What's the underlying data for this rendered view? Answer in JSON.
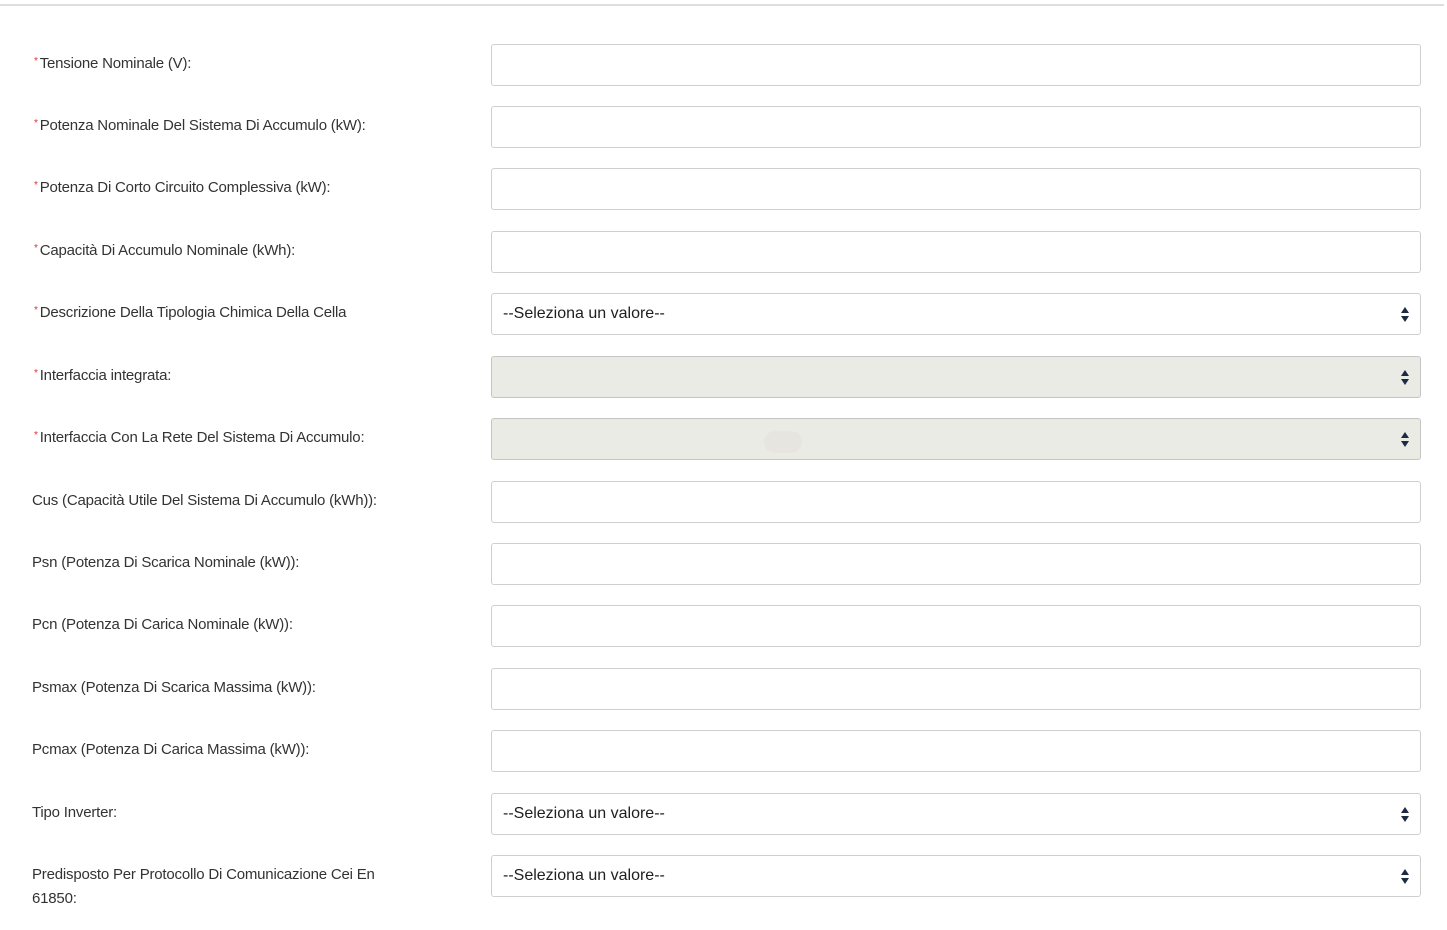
{
  "form": {
    "select_placeholder": "--Seleziona un valore--",
    "fields": [
      {
        "label": "Tensione Nominale (V):",
        "required": true,
        "type": "input",
        "value": ""
      },
      {
        "label": "Potenza Nominale Del Sistema Di Accumulo (kW):",
        "required": true,
        "type": "input",
        "value": ""
      },
      {
        "label": "Potenza Di Corto Circuito Complessiva (kW):",
        "required": true,
        "type": "input",
        "value": ""
      },
      {
        "label": "Capacità Di Accumulo Nominale (kWh):",
        "required": true,
        "type": "input",
        "value": ""
      },
      {
        "label": "Descrizione Della Tipologia Chimica Della Cella",
        "required": true,
        "type": "select",
        "value": "--Seleziona un valore--"
      },
      {
        "label": "Interfaccia integrata:",
        "required": true,
        "type": "select-disabled",
        "value": ""
      },
      {
        "label": "Interfaccia Con La Rete Del Sistema Di Accumulo:",
        "required": true,
        "type": "select-disabled",
        "value": ""
      },
      {
        "label": "Cus (Capacità Utile Del Sistema Di Accumulo (kWh)):",
        "required": false,
        "type": "input",
        "value": ""
      },
      {
        "label": "Psn (Potenza Di Scarica Nominale (kW)):",
        "required": false,
        "type": "input",
        "value": ""
      },
      {
        "label": "Pcn (Potenza Di Carica Nominale (kW)):",
        "required": false,
        "type": "input",
        "value": ""
      },
      {
        "label": "Psmax (Potenza Di Scarica Massima (kW)):",
        "required": false,
        "type": "input",
        "value": ""
      },
      {
        "label": "Pcmax (Potenza Di Carica Massima (kW)):",
        "required": false,
        "type": "input",
        "value": ""
      },
      {
        "label": "Tipo Inverter:",
        "required": false,
        "type": "select",
        "value": "--Seleziona un valore--"
      },
      {
        "label": "Predisposto Per Protocollo Di Comunicazione Cei En 61850:",
        "required": false,
        "type": "select",
        "value": "--Seleziona un valore--"
      }
    ]
  },
  "colors": {
    "required_star": "#d9343b",
    "disabled_bg": "#ebebe6",
    "border": "#cfcfcf"
  }
}
